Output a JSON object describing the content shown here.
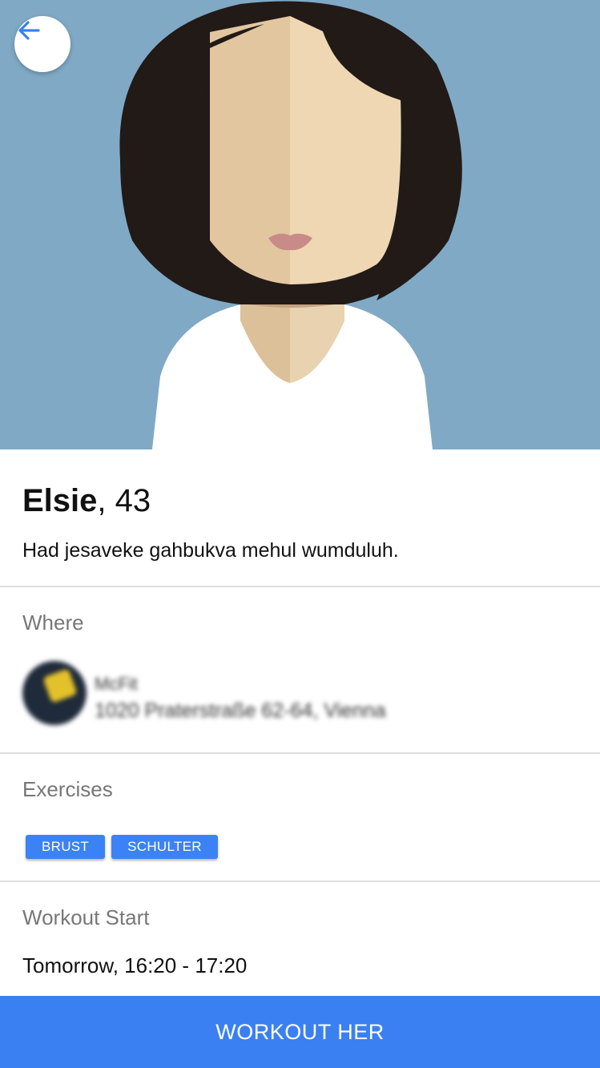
{
  "header": {
    "back_icon": "arrow-left-icon",
    "accent_color": "#3a80f2"
  },
  "profile": {
    "name": "Elsie",
    "separator": ", ",
    "age": "43",
    "bio": "Had jesaveke gahbukva mehul wumduluh."
  },
  "where": {
    "label": "Where",
    "gym_name": "McFit",
    "gym_address": "1020 Praterstraße 62-64, Vienna"
  },
  "exercises": {
    "label": "Exercises",
    "tags": [
      "BRUST",
      "SCHULTER"
    ]
  },
  "workout_start": {
    "label": "Workout Start",
    "time": "Tomorrow, 16:20 - 17:20"
  },
  "cta": {
    "label": "WORKOUT HER"
  }
}
